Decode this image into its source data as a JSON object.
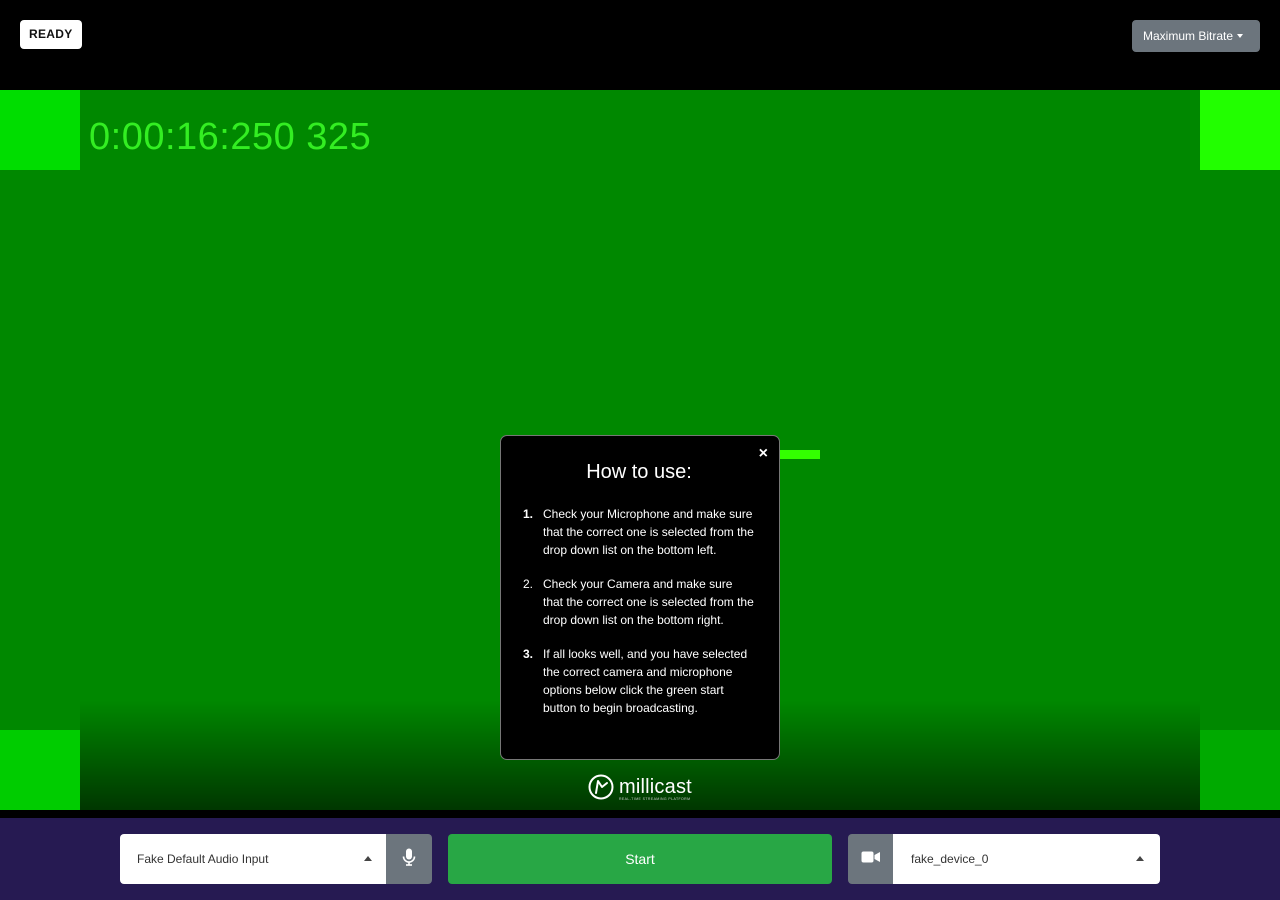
{
  "header": {
    "status_badge": "READY",
    "bitrate_label": "Maximum Bitrate"
  },
  "stage": {
    "timecode": "0:00:16:250 325"
  },
  "modal": {
    "title": "How to use:",
    "close_symbol": "×",
    "steps": [
      {
        "number": "1.",
        "text": "Check your Microphone and make sure that the correct one is selected from the drop down list on the bottom left."
      },
      {
        "number": "2.",
        "text": "Check your Camera and make sure that the correct one is selected from the drop down list on the bottom right."
      },
      {
        "number": "3.",
        "text": "If all looks well, and you have selected the correct camera and microphone options below click the green start button to begin broadcasting."
      }
    ]
  },
  "logo": {
    "name": "millicast",
    "tagline": "REAL-TIME STREAMING PLATFORM"
  },
  "controls": {
    "audio_input_value": "Fake Default Audio Input",
    "start_label": "Start",
    "video_input_value": "fake_device_0"
  },
  "icons": {
    "mic": "microphone-icon",
    "camera": "video-camera-icon",
    "close": "close-icon",
    "caret": "chevron-down-icon",
    "logo": "millicast-logo-icon"
  },
  "colors": {
    "stage_green": "#008800",
    "start_green": "#28a745",
    "control_bar": "#261a52",
    "secondary_button": "#6c757d",
    "timecode_green": "#33ee22"
  }
}
